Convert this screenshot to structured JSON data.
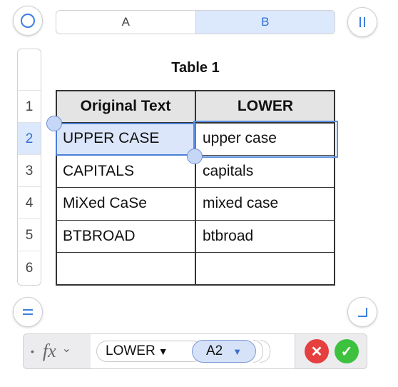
{
  "columns": [
    "A",
    "B"
  ],
  "rows": [
    "1",
    "2",
    "3",
    "4",
    "5",
    "6"
  ],
  "table": {
    "title": "Table 1",
    "headers": [
      "Original Text",
      "LOWER"
    ],
    "body": [
      [
        "UPPER CASE",
        "upper case"
      ],
      [
        "CAPITALS",
        "capitals"
      ],
      [
        "MiXed CaSe",
        "mixed case"
      ],
      [
        "BTBROAD",
        "btbroad"
      ],
      [
        "",
        ""
      ]
    ]
  },
  "formula_bar": {
    "bullet": "•",
    "fx_label": "fx",
    "fx_chevron": "⌄",
    "function_name": "LOWER",
    "function_caret": "▼",
    "argument": "A2",
    "argument_caret": "▼"
  },
  "icons": {
    "cancel": "✕",
    "accept": "✓"
  },
  "colors": {
    "selection": "#dce8fb",
    "accent": "#2f6fd6",
    "cancel": "#e53f3f",
    "accept": "#3ec13f"
  }
}
